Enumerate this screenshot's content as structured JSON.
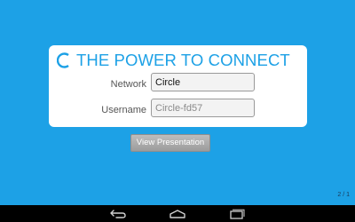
{
  "colors": {
    "background": "#1da1e6",
    "card": "#ffffff",
    "accent": "#1da1e6",
    "navbar": "#000000"
  },
  "header": {
    "logo_icon": "circle-logo-icon",
    "tagline": "THE POWER TO CONNECT"
  },
  "form": {
    "network_label": "Network",
    "network_value": "Circle",
    "username_label": "Username",
    "username_placeholder": "Circle-fd57"
  },
  "actions": {
    "view_presentation_label": "View Presentation"
  },
  "page_indicator": "2 / 1",
  "navbar": {
    "icons": [
      "back-icon",
      "home-icon",
      "recent-apps-icon"
    ]
  }
}
